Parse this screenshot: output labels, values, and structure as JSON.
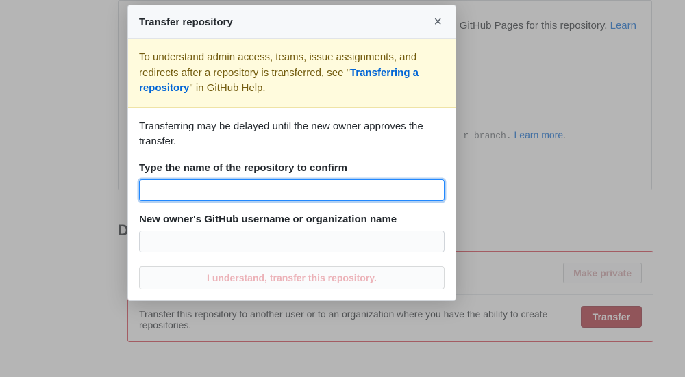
{
  "background": {
    "pages_text_suffix": "GitHub Pages for this repository.",
    "pages_learn": "Learn",
    "branch_text_prefix": "r branch.",
    "branch_learn": "Learn more",
    "branch_period": ".",
    "danger_heading_first_char": "D",
    "make_private_label": "Make private",
    "transfer_desc": "Transfer this repository to another user or to an organization where you have the ability to create repositories.",
    "transfer_button": "Transfer"
  },
  "modal": {
    "title": "Transfer repository",
    "close_symbol": "×",
    "warning_prefix": "To understand admin access, teams, issue assignments, and redirects after a repository is transferred, see \"",
    "warning_link": "Transferring a repository",
    "warning_suffix": "\" in GitHub Help.",
    "info": "Transferring may be delayed until the new owner approves the transfer.",
    "repo_label": "Type the name of the repository to confirm",
    "repo_value": "",
    "owner_label": "New owner's GitHub username or organization name",
    "owner_value": "",
    "confirm_button": "I understand, transfer this repository."
  }
}
